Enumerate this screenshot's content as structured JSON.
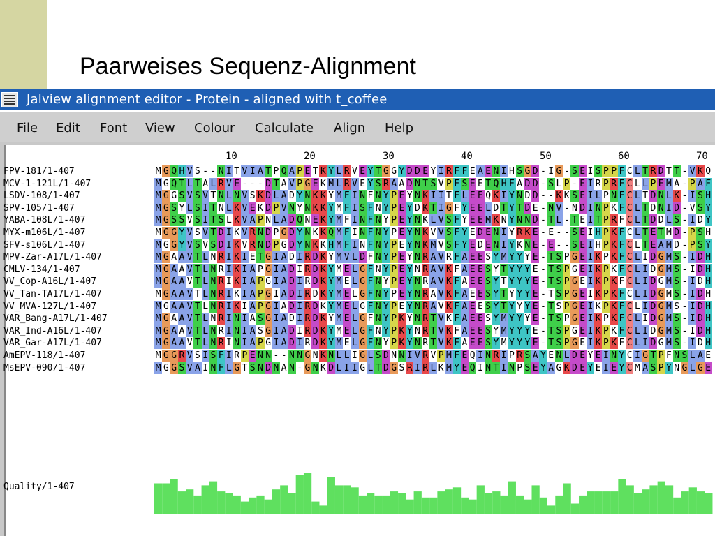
{
  "slide": {
    "title": "Paarweises Sequenz-Alignment"
  },
  "window": {
    "title": "Jalview alignment editor - Protein - aligned with t_coffee"
  },
  "menu": [
    "File",
    "Edit",
    "Font",
    "View",
    "Colour",
    "Calculate",
    "Align",
    "Help"
  ],
  "ruler": [
    "10",
    "20",
    "30",
    "40",
    "50",
    "60",
    "70"
  ],
  "sequences": [
    {
      "name": "FPV-181/1-407",
      "seq": "MGQHVS--NITVIATPQAPETKYLRVEYTGGYDDEYIRFFEAENIHSGD-IG-SEISPPFCLTRDTT-VKQ"
    },
    {
      "name": "MCV-1-121L/1-407",
      "seq": "MGQTLTALRVE---DTAVPGEKMLRVEYSRAADNTSVPFSEETQHFADD-SLP-EIRPRFCLLPEMA-PAF"
    },
    {
      "name": "LSDV-108/1-407",
      "seq": "MGGSVSVTNLNVSKDLADYNKKYMFINFNYPEYNKIITFLEEQKIYNDD--KKSEILPNFCLTDNLK-ISH"
    },
    {
      "name": "SPV-105/1-407",
      "seq": "MGSYLSITNLKVEKDPVNYNKKYMFISFNYPEYDKTIGFYEELDTYTDE-NV-NDINPKFCLTDNID-VSY"
    },
    {
      "name": "YABA-108L/1-407",
      "seq": "MGSSVSITSLKVAPNLADQNEKYMFINFNYPEYNKLVSFYEEMKNYNND-TL-TEITPRFCLTDDLS-IDY"
    },
    {
      "name": "MYX-m106L/1-407",
      "seq": "MGGYVSVTDIKVRNDPGDYNKKQMFINFNYPEYNKVVSFYEDENIYRKE-E--SEIHPKFCLTETMD-PSH"
    },
    {
      "name": "SFV-s106L/1-407",
      "seq": "MGGYVSVSDIKVRNDPGDYNKKHMFINFNYPEYNKMVSFYEDENIYKNE-E--SEIHPKFCLTEAMD-PSY"
    },
    {
      "name": "MPV-Zar-A17L/1-407",
      "seq": "MGAAVTLNRIKIETGIADIRDKYMVLDFNYPEYNRAVRFAEESYMYYYE-TSPGEIKPKFCLIDGMS-IDH"
    },
    {
      "name": "CMLV-134/1-407",
      "seq": "MGAAVTLNRIKIAPGIADIRDKYMELGFNYPEYNRAVKFAEESYTYYYE-TSPGEIKPKFCLIDGMS-IDH"
    },
    {
      "name": "VV_Cop-A16L/1-407",
      "seq": "MGAAVTLNRIKIAPGIADIRDKYMELGFNYPEYNRAVKFAEESYTYYYE-TSPGEIKPKFCLIDGMS-IDH"
    },
    {
      "name": "VV_Tan-TA17L/1-407",
      "seq": "MGAAVTLNRIKIAPGIADIRDKYMELGFNYPEYNRAVKFAEESYTYYYE-TSPGEIKPKFCLIDGMS-IDH"
    },
    {
      "name": "VV_MVA-127L/1-407",
      "seq": "MGAAVTLNRIKIAPGIADIRDKYMELGFNYPEYNRAVKFAEESYTYYYE-TSPGEIKPKFCLIDGMS-IDH"
    },
    {
      "name": "VAR_Bang-A17L/1-407",
      "seq": "MGAAVTLNRINIASGIADIRDKYMELGFNYPKYNRTVKFAEESYMYYYE-TSPGEIKPKFCLIDGMS-IDH"
    },
    {
      "name": "VAR_Ind-A16L/1-407",
      "seq": "MGAAVTLNRINIASGIADIRDKYMELGFNYPKYNRTVKFAEESYMYYYE-TSPGEIKPKFCLIDGMS-IDH"
    },
    {
      "name": "VAR_Gar-A17L/1-407",
      "seq": "MGAAVTLNRINIAPGIADIRDKYMELGFNYPKYNRTVKFAEESYMYYYE-TSPGEIKPKFCLIDGMS-IDH"
    },
    {
      "name": "AmEPV-118/1-407",
      "seq": "MGGRVSISFIRPENN--NNGNKNLLIGLSDNNIVRVPMFEQINRIPRSAYENLDEYEINYCIGTPFNSLAE"
    },
    {
      "name": "MsEPV-090/1-407",
      "seq": "MGGSVAINFLGTSNDNAN-GNKDLIIGLTDGSRIRLKMYEQINTINPSEYAGKDEYEIEYCMASPYNGLGE"
    }
  ],
  "quality": {
    "label": "Quality/1-407",
    "color": "#5fe05f",
    "values": [
      0.75,
      0.75,
      0.85,
      0.55,
      0.6,
      0.45,
      0.7,
      0.8,
      0.55,
      0.5,
      0.45,
      0.3,
      0.4,
      0.45,
      0.35,
      0.6,
      0.7,
      0.5,
      0.95,
      1.0,
      0.3,
      0.2,
      0.9,
      0.7,
      0.7,
      0.65,
      0.45,
      0.5,
      0.45,
      0.45,
      0.55,
      0.5,
      0.35,
      0.55,
      0.4,
      0.4,
      0.55,
      0.6,
      0.65,
      0.4,
      0.35,
      0.7,
      0.5,
      0.55,
      0.45,
      0.8,
      0.45,
      0.35,
      0.7,
      0.4,
      0.2,
      0.45,
      0.75,
      0.25,
      0.45,
      0.55,
      0.55,
      0.55,
      0.55,
      0.85,
      0.7,
      0.5,
      0.6,
      0.7,
      0.8,
      0.7,
      0.4,
      0.55,
      0.65,
      0.55,
      0.5
    ]
  },
  "colors": {
    "hydrophobic": "#8aa3e8",
    "positive": "#e8484a",
    "negative": "#c54bc9",
    "polar": "#3fcf4a",
    "cys": "#f08080",
    "gly": "#e89a5a",
    "pro": "#d6d64a",
    "aromatic": "#3ec5c5",
    "titlebar": "#1f5fb4"
  }
}
